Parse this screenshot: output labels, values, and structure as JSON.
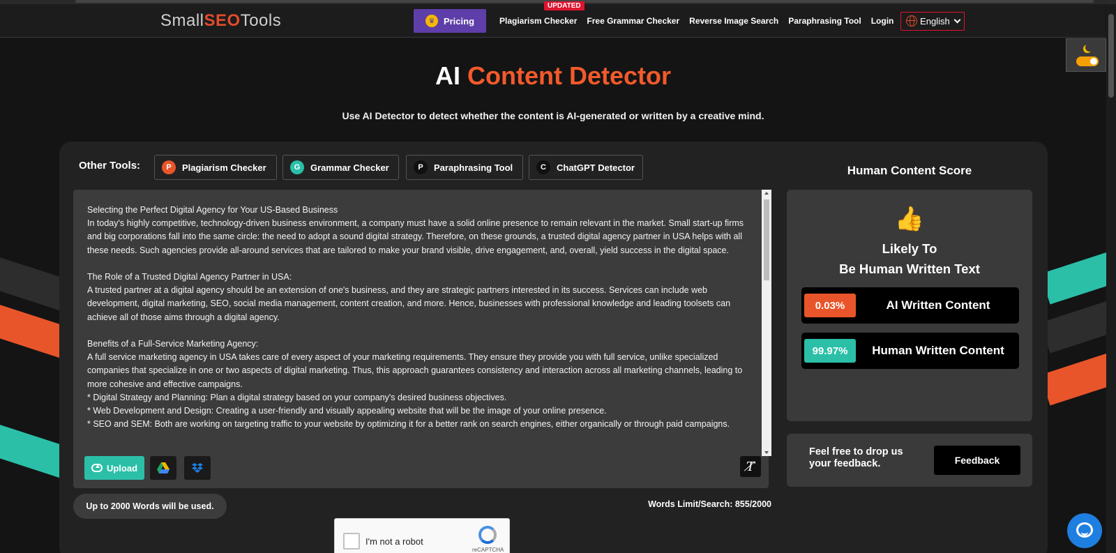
{
  "header": {
    "logo": {
      "part1": "Small",
      "part2": "SEO",
      "part3": "Tools"
    },
    "pricing_label": "Pricing",
    "updated_badge": "UPDATED",
    "nav": [
      "Plagiarism Checker",
      "Free Grammar Checker",
      "Reverse Image Search",
      "Paraphrasing Tool",
      "Login"
    ],
    "language": "English"
  },
  "hero": {
    "title_part1": "AI",
    "title_part2": "Content Detector",
    "subtitle": "Use AI Detector to detect whether the content is AI-generated or written by a creative mind."
  },
  "tools": {
    "label": "Other Tools:",
    "items": [
      {
        "letter": "P",
        "label": "Plagiarism Checker",
        "color": "#e9552a"
      },
      {
        "letter": "G",
        "label": "Grammar Checker",
        "color": "#2bbfa8"
      },
      {
        "letter": "P",
        "label": "Paraphrasing Tool",
        "color": "#111111"
      },
      {
        "letter": "C",
        "label": "ChatGPT Detector",
        "color": "#111111"
      }
    ]
  },
  "editor": {
    "content": "Selecting the Perfect Digital Agency for Your US-Based Business\nIn today's highly competitive, technology-driven business environment, a company must have a solid online presence to remain relevant in the market. Small start-up firms and big corporations fall into the same circle: the need to adopt a sound digital strategy. Therefore, on these grounds, a trusted digital agency partner in USA helps with all these needs. Such agencies provide all-around services that are tailored to make your brand visible, drive engagement, and, overall, yield success in the digital space.\n\nThe Role of a Trusted Digital Agency Partner in USA:\nA trusted partner at a digital agency should be an extension of one's business, and they are strategic partners interested in its success. Services can include web development, digital marketing, SEO, social media management, content creation, and more. Hence, businesses with professional knowledge and leading toolsets can achieve all of those aims through a digital agency.\n\nBenefits of a Full-Service Marketing Agency:\nA full service marketing agency in USA takes care of every aspect of your marketing requirements. They ensure they provide you with full service, unlike specialized companies that specialize in one or two aspects of digital marketing. Thus, this approach guarantees consistency and interaction across all marketing channels, leading to more cohesive and effective campaigns.\n* Digital Strategy and Planning: Plan a digital strategy based on your company's desired business objectives.\n* Web Development and Design: Creating a user-friendly and visually appealing website that will be the image of your online presence.\n* SEO and SEM: Both are working on targeting traffic to your website by optimizing it for a better rank on search engines, either organically or through paid campaigns.",
    "upload_label": "Upload",
    "limit_note": "Up to 2000 Words will be used.",
    "words_limit": "Words Limit/Search: 855/2000"
  },
  "captcha": {
    "label": "I'm not a robot",
    "brand": "reCAPTCHA"
  },
  "score": {
    "title": "Human Content Score",
    "verdict_line1": "Likely To",
    "verdict_line2": "Be Human Written Text",
    "ai_percent": "0.03%",
    "ai_label": "AI Written Content",
    "human_percent": "99.97%",
    "human_label": "Human Written Content",
    "ai_color": "#e9552a",
    "human_color": "#2bbfa8"
  },
  "feedback": {
    "text": "Feel free to drop us your feedback.",
    "button": "Feedback"
  }
}
